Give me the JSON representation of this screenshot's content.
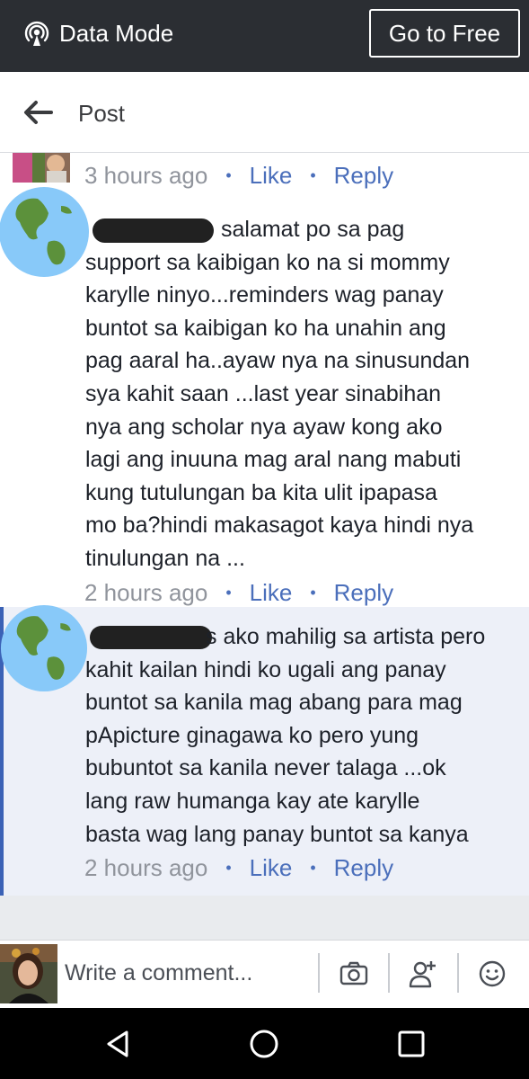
{
  "status_bar": {
    "data_mode_label": "Data Mode",
    "go_free_label": "Go to Free"
  },
  "header": {
    "title": "Post"
  },
  "comments": [
    {
      "time": "3 hours ago",
      "like": "Like",
      "reply": "Reply"
    },
    {
      "lines": [
        "salamat po sa pag",
        "support sa kaibigan ko na si mommy",
        "karylle ninyo...reminders wag panay",
        "buntot sa kaibigan ko ha unahin ang",
        "pag aaral ha..ayaw nya na sinusundan",
        "sya kahit saan ...last year sinabihan",
        "nya ang scholar nya ayaw kong ako",
        "lagi ang inuuna mag aral nang mabuti",
        "kung tutulungan ba kita ulit ipapasa",
        "mo ba?hindi makasagot kaya hindi nya",
        "tinulungan na ..."
      ],
      "time": "2 hours ago",
      "like": "Like",
      "reply": "Reply"
    },
    {
      "lines": [
        "s ako mahilig sa artista pero",
        "kahit kailan hindi ko ugali ang panay",
        "buntot sa kanila mag abang para mag",
        "pApicture ginagawa ko pero yung",
        "bubuntot sa kanila never talaga ...ok",
        "lang raw humanga kay ate karylle",
        "basta wag lang panay buntot sa kanya"
      ],
      "time": "2 hours ago",
      "like": "Like",
      "reply": "Reply"
    }
  ],
  "composer": {
    "placeholder": "Write a comment..."
  },
  "colors": {
    "top_bar": "#2b2e33",
    "link_blue": "#4b6fbb",
    "reply_bg": "#edf0f8",
    "reply_border": "#3b62b6",
    "meta_gray": "#90949c"
  },
  "icons": [
    "broadcast-icon",
    "back-arrow-icon",
    "globe-icon",
    "camera-icon",
    "add-friend-icon",
    "smiley-icon",
    "nav-back-icon",
    "nav-home-icon",
    "nav-recents-icon"
  ]
}
